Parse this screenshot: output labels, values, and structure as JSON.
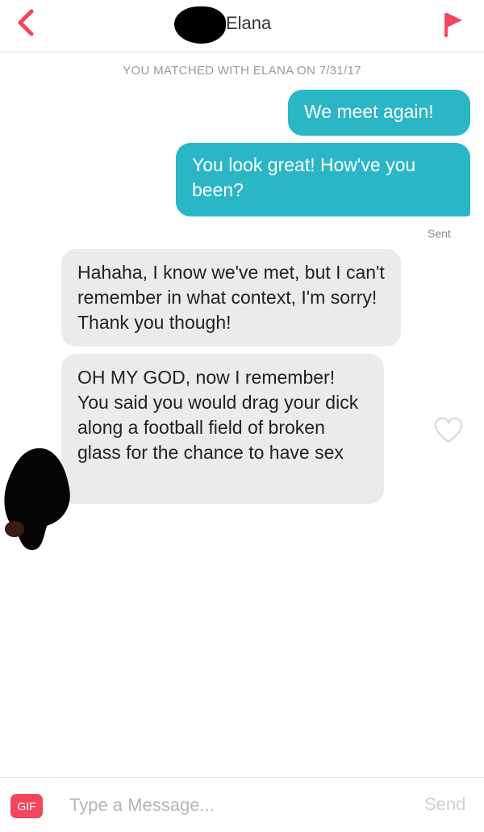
{
  "header": {
    "contact_name": "Elana",
    "back_icon": "chevron-left-icon",
    "report_icon": "flag-icon",
    "accent_color": "#f3465e"
  },
  "match_banner": "YOU MATCHED WITH ELANA ON 7/31/17",
  "messages": [
    {
      "direction": "outgoing",
      "text": "We meet again!"
    },
    {
      "direction": "outgoing",
      "text": "You look great! How've you been?"
    },
    {
      "direction": "incoming",
      "text": "Hahaha, I know we've met, but I can't remember in what context, I'm sorry! Thank you though!"
    },
    {
      "direction": "incoming",
      "text": "OH MY GOD, now I remember! You said you would drag your dick along a football field of broken glass for the chance to have sex"
    }
  ],
  "sent_status": "Sent",
  "composer": {
    "gif_label": "GIF",
    "placeholder": "Type a Message...",
    "send_label": "Send"
  },
  "colors": {
    "outgoing_bubble": "#2bb6c6",
    "incoming_bubble": "#ebebeb",
    "brand": "#f3465e"
  }
}
